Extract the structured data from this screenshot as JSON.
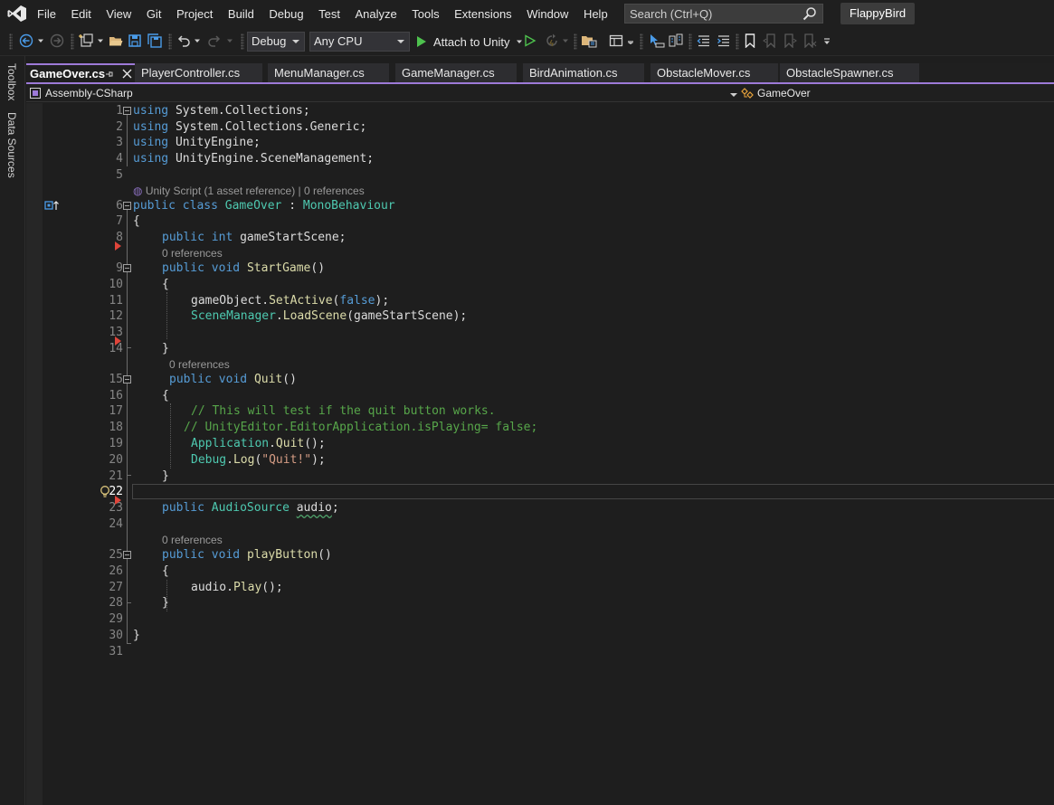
{
  "menu": {
    "items": [
      "File",
      "Edit",
      "View",
      "Git",
      "Project",
      "Build",
      "Debug",
      "Test",
      "Analyze",
      "Tools",
      "Extensions",
      "Window",
      "Help"
    ],
    "search_placeholder": "Search (Ctrl+Q)",
    "solution_name": "FlappyBird"
  },
  "toolbar": {
    "configuration": "Debug",
    "platform": "Any CPU",
    "attach_label": "Attach to Unity"
  },
  "left_strip": {
    "items": [
      "Toolbox",
      "Data Sources"
    ]
  },
  "tabs": [
    {
      "label": "GameOver.cs",
      "active": true
    },
    {
      "label": "PlayerController.cs",
      "active": false
    },
    {
      "label": "MenuManager.cs",
      "active": false
    },
    {
      "label": "GameManager.cs",
      "active": false
    },
    {
      "label": "BirdAnimation.cs",
      "active": false
    },
    {
      "label": "ObstacleMover.cs",
      "active": false
    },
    {
      "label": "ObstacleSpawner.cs",
      "active": false
    }
  ],
  "navbar": {
    "project": "Assembly-CSharp",
    "member": "GameOver"
  },
  "editor": {
    "current_line": 22,
    "line_numbers": [
      "1",
      "2",
      "3",
      "4",
      "5",
      "6",
      "7",
      "8",
      "9",
      "10",
      "11",
      "12",
      "13",
      "14",
      "15",
      "16",
      "17",
      "18",
      "19",
      "20",
      "21",
      "22",
      "23",
      "24",
      "25",
      "26",
      "27",
      "28",
      "29",
      "30",
      "31"
    ],
    "codelens": {
      "class": "Unity Script (1 asset reference) | 0 references",
      "start_game": "0 references",
      "quit": "0 references",
      "play_button": "0 references"
    },
    "code": {
      "l1_kw": "using",
      "l1_ns": " System.Collections;",
      "l2_kw": "using",
      "l2_ns": " System.Collections.Generic;",
      "l3_kw": "using",
      "l3_ns": " UnityEngine;",
      "l4_kw": "using",
      "l4_ns": " UnityEngine.SceneManagement;",
      "l6_kw1": "public",
      "l6_kw2": "class",
      "l6_name": "GameOver",
      "l6_colon": " : ",
      "l6_base": "MonoBehaviour",
      "l7": "{",
      "l8_kw1": "public",
      "l8_kw2": "int",
      "l8_rest": " gameStartScene;",
      "l9_kw1": "public",
      "l9_kw2": "void",
      "l9_method": "StartGame",
      "l9_rest": "()",
      "l10": "{",
      "l11_obj": "gameObject.",
      "l11_method": "SetActive",
      "l11_p1": "(",
      "l11_kw": "false",
      "l11_p2": ");",
      "l12_type": "SceneManager",
      "l12_dot": ".",
      "l12_method": "LoadScene",
      "l12_rest": "(gameStartScene);",
      "l14": "}",
      "l15_kw1": "public",
      "l15_kw2": "void",
      "l15_method": "Quit",
      "l15_rest": "()",
      "l16": "{",
      "l17": "// This will test if the quit button works.",
      "l18": "// UnityEditor.EditorApplication.isPlaying= false;",
      "l19_type": "Application",
      "l19_dot": ".",
      "l19_method": "Quit",
      "l19_rest": "();",
      "l20_type": "Debug",
      "l20_dot": ".",
      "l20_method": "Log",
      "l20_p1": "(",
      "l20_str": "\"Quit!\"",
      "l20_p2": ");",
      "l21": "}",
      "l23_kw": "public",
      "l23_type": "AudioSource",
      "l23_var": "audio",
      "l23_semi": ";",
      "l25_kw1": "public",
      "l25_kw2": "void",
      "l25_method": "playButton",
      "l25_rest": "()",
      "l26": "{",
      "l27_obj": "audio.",
      "l27_method": "Play",
      "l27_rest": "();",
      "l28": "}",
      "l30": "}"
    }
  },
  "colors": {
    "keyword": "#569cd6",
    "type": "#4ec9b0",
    "method": "#dcdcaa",
    "comment": "#57a64a",
    "string": "#d69d85",
    "accent": "#9d7ad8",
    "breakpoint_arrow": "#e0453a"
  },
  "icons": [
    "vs-logo-icon",
    "search-icon",
    "back-icon",
    "forward-icon",
    "new-project-icon",
    "open-folder-icon",
    "save-icon",
    "save-all-icon",
    "undo-icon",
    "redo-icon",
    "start-icon",
    "start-without-debugging-icon",
    "hot-reload-icon",
    "solution-explorer-icon",
    "pin-icon",
    "close-icon",
    "bookmark-icon",
    "lightbulb-icon",
    "class-inherit-icon"
  ]
}
